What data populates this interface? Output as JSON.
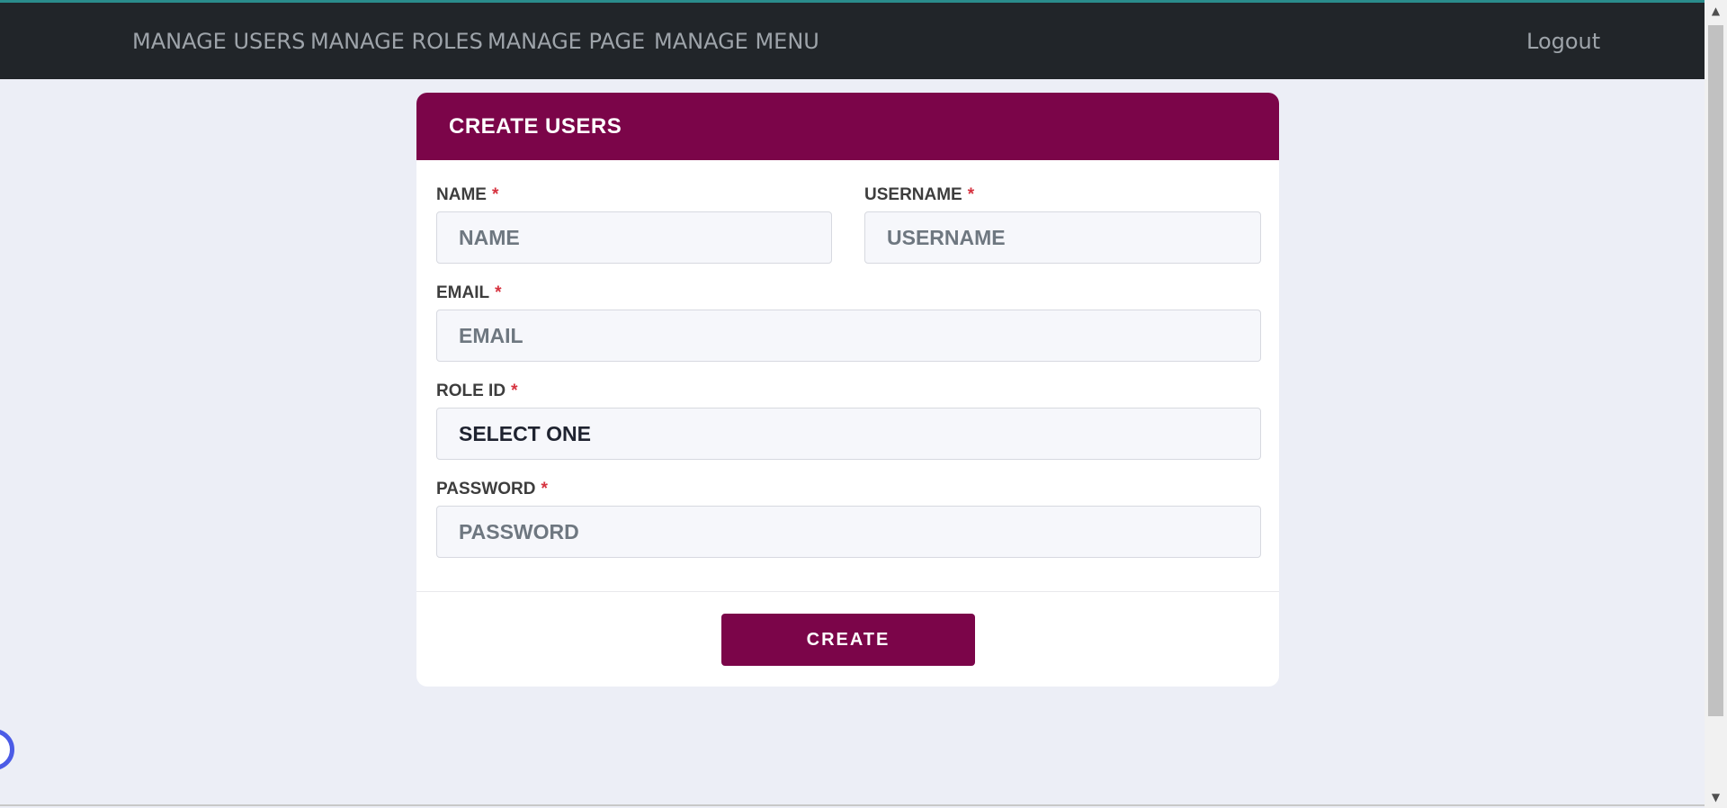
{
  "nav": {
    "items": [
      {
        "label": "MANAGE USERS"
      },
      {
        "label": "MANAGE ROLES"
      },
      {
        "label": "MANAGE PAGE"
      },
      {
        "label": "MANAGE MENU"
      }
    ],
    "logout": "Logout"
  },
  "form": {
    "title": "CREATE USERS",
    "required_mark": "*",
    "name": {
      "label": "NAME",
      "placeholder": "NAME"
    },
    "username": {
      "label": "USERNAME",
      "placeholder": "USERNAME"
    },
    "email": {
      "label": "EMAIL",
      "placeholder": "EMAIL"
    },
    "role": {
      "label": "ROLE ID",
      "selected": "SELECT ONE"
    },
    "password": {
      "label": "PASSWORD",
      "placeholder": "PASSWORD"
    },
    "submit_label": "CREATE"
  },
  "colors": {
    "navbar": "#212529",
    "accent": "#7b0549",
    "required": "#d6323f",
    "background": "#eceef6"
  },
  "icons": {
    "scroll_up": "scroll-up-arrow-icon",
    "scroll_down": "scroll-down-arrow-icon",
    "widget": "chat-widget-icon"
  }
}
